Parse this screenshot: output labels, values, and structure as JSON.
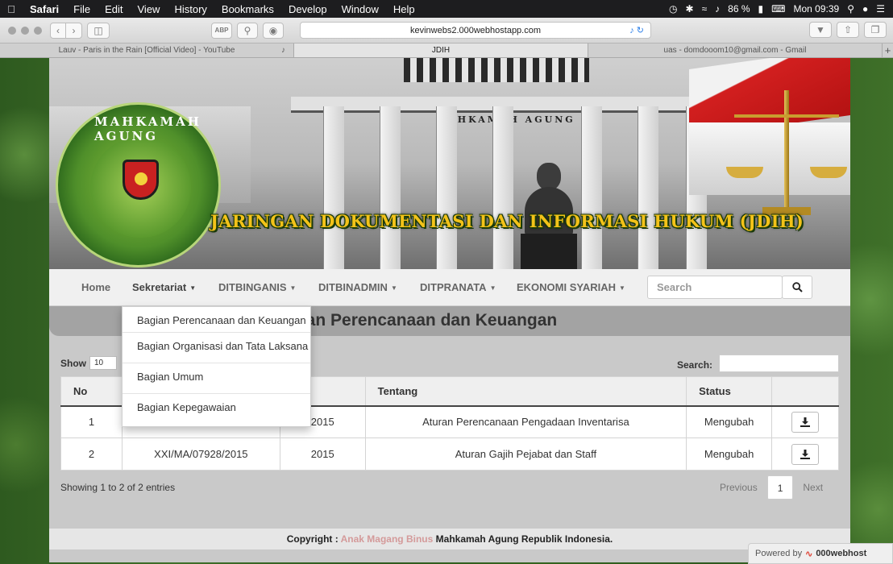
{
  "menubar": {
    "app": "Safari",
    "items": [
      "File",
      "Edit",
      "View",
      "History",
      "Bookmarks",
      "Develop",
      "Window",
      "Help"
    ],
    "battery": "86 %",
    "clock": "Mon 09:39"
  },
  "browser": {
    "url": "kevinwebs2.000webhostapp.com",
    "tabs": [
      {
        "label": "Lauv - Paris in the Rain [Official Video] - YouTube",
        "active": false
      },
      {
        "label": "JDIH",
        "active": true
      },
      {
        "label": "uas - domdooom10@gmail.com - Gmail",
        "active": false
      }
    ]
  },
  "banner": {
    "emblem_text": "MAHKAMAH AGUNG",
    "building_sign": "MAHKAMAH AGUNG",
    "title": "JARINGAN DOKUMENTASI DAN INFORMASI HUKUM (JDIH)"
  },
  "nav": {
    "home": "Home",
    "sekretariat": "Sekretariat",
    "ditbinganis": "DITBINGANIS",
    "ditbinadmin": "DITBINADMIN",
    "ditpranata": "DITPRANATA",
    "ekonomi": "EKONOMI SYARIAH",
    "search_placeholder": "Search"
  },
  "dropdown": {
    "items": [
      "Bagian Perencanaan dan Keuangan",
      "Bagian Organisasi dan Tata Laksana",
      "Bagian Umum",
      "Bagian Kepegawaian"
    ]
  },
  "page": {
    "title_visible": "gian Perencanaan dan Keuangan"
  },
  "table": {
    "show_label": "Show",
    "page_size": "10",
    "search_label": "Search:",
    "columns": [
      "No",
      "",
      "un",
      "Tentang",
      "Status",
      ""
    ],
    "rows": [
      {
        "no": "1",
        "nomor": "",
        "tahun": "2015",
        "tentang": "Aturan Perencanaan Pengadaan Inventarisa",
        "status": "Mengubah"
      },
      {
        "no": "2",
        "nomor": "XXI/MA/07928/2015",
        "tahun": "2015",
        "tentang": "Aturan Gajih Pejabat dan Staff",
        "status": "Mengubah"
      }
    ],
    "info": "Showing 1 to 2 of 2 entries",
    "prev": "Previous",
    "current_page": "1",
    "next": "Next"
  },
  "footer": {
    "prefix": "Copyright :",
    "link": "Anak Magang Binus",
    "suffix": "Mahkamah Agung Republik Indonesia."
  },
  "powered": {
    "label": "Powered by",
    "brand": "000webhost"
  }
}
